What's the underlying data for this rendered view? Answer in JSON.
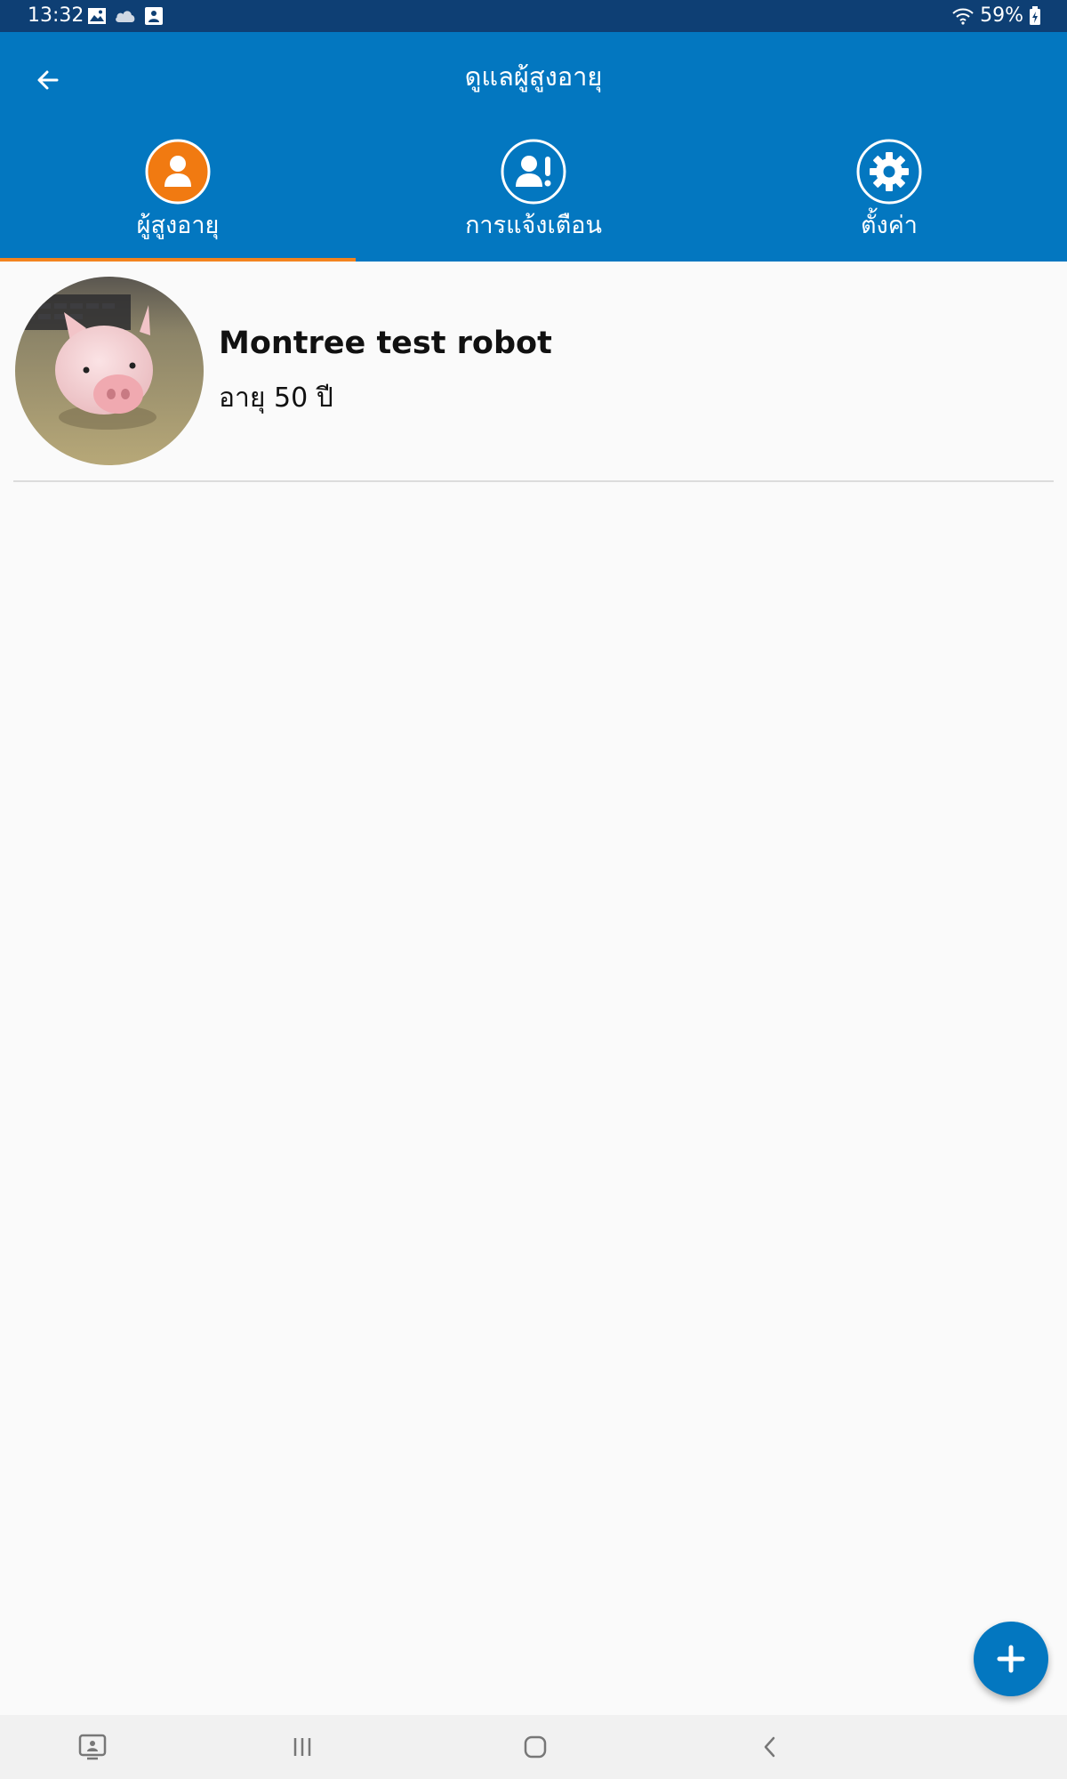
{
  "status_bar": {
    "time": "13:32",
    "battery": "59%",
    "icons": [
      "image-icon",
      "cloud-icon",
      "notification-icon",
      "wifi-icon",
      "battery-icon"
    ]
  },
  "app_bar": {
    "title": "ดูแลผู้สูงอายุ",
    "back_icon": "arrow-left-icon"
  },
  "tabs": [
    {
      "label": "ผู้สูงอายุ",
      "icon": "person-icon",
      "selected": true
    },
    {
      "label": "การแจ้งเตือน",
      "icon": "person-alert-icon",
      "selected": false
    },
    {
      "label": "ตั้งค่า",
      "icon": "gear-icon",
      "selected": false
    }
  ],
  "elderly_list": [
    {
      "name": "Montree test robot",
      "age_text": "อายุ 50 ปี",
      "avatar": "pig-figurine-photo"
    }
  ],
  "fab": {
    "icon": "plus-icon"
  },
  "nav_bar": {
    "icons": [
      "screenshot-icon",
      "recents-icon",
      "home-icon",
      "back-icon"
    ]
  },
  "colors": {
    "status_bar": "#0e3f74",
    "app_bar": "#0377c0",
    "accent": "#f3831e",
    "background": "#fafafa"
  }
}
